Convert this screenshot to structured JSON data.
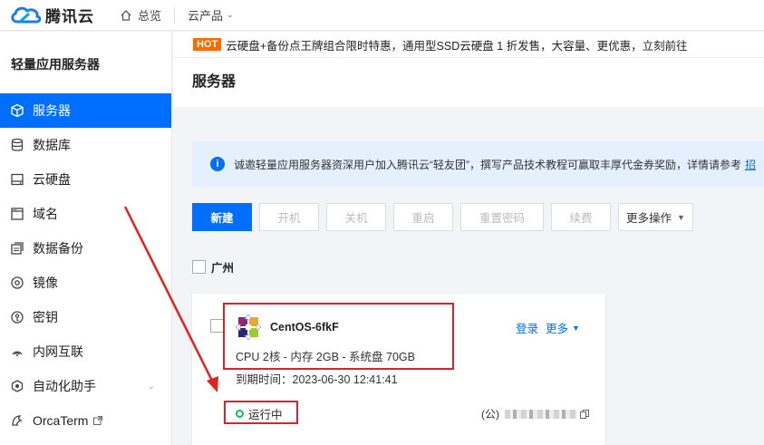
{
  "header": {
    "brand": "腾讯云",
    "overview_label": "总览",
    "products_label": "云产品"
  },
  "sidebar": {
    "title": "轻量应用服务器",
    "items": [
      {
        "label": "服务器",
        "icon": "cube-icon",
        "active": true
      },
      {
        "label": "数据库",
        "icon": "database-icon"
      },
      {
        "label": "云硬盘",
        "icon": "disk-icon"
      },
      {
        "label": "域名",
        "icon": "domain-icon"
      },
      {
        "label": "数据备份",
        "icon": "backup-icon"
      },
      {
        "label": "镜像",
        "icon": "image-icon"
      },
      {
        "label": "密钥",
        "icon": "key-icon"
      },
      {
        "label": "内网互联",
        "icon": "network-icon"
      },
      {
        "label": "自动化助手",
        "icon": "automation-icon",
        "expandable": true
      },
      {
        "label": "OrcaTerm",
        "icon": "terminal-icon",
        "external": true
      }
    ]
  },
  "promo": {
    "badge": "HOT",
    "text": "云硬盘+备份点王牌组合限时特惠，通用型SSD云硬盘 1 折发售，大容量、更优惠，立刻前往"
  },
  "page": {
    "title": "服务器"
  },
  "notice": {
    "icon": "info-icon",
    "text": "诚邀轻量应用服务器资深用户加入腾讯云“轻友团”，撰写产品技术教程可赢取丰厚代金券奖励，详情请参考",
    "link": "招"
  },
  "toolbar": {
    "new_label": "新建",
    "start_label": "开机",
    "shutdown_label": "关机",
    "restart_label": "重启",
    "reset_password_label": "重置密码",
    "renew_label": "续费",
    "more_label": "更多操作"
  },
  "region": {
    "label": "广州"
  },
  "instance": {
    "os_name": "CentOS-6fkF",
    "spec": "CPU 2核 - 内存 2GB - 系统盘 70GB",
    "expire": "到期时间：2023-06-30 12:41:41",
    "login_label": "登录",
    "more_label": "更多",
    "status": "运行中",
    "ip_prefix": "(公)"
  },
  "colors": {
    "accent": "#006eff",
    "hot": "#ff6a00",
    "highlight": "#d6232c",
    "running": "#0abf5b"
  }
}
